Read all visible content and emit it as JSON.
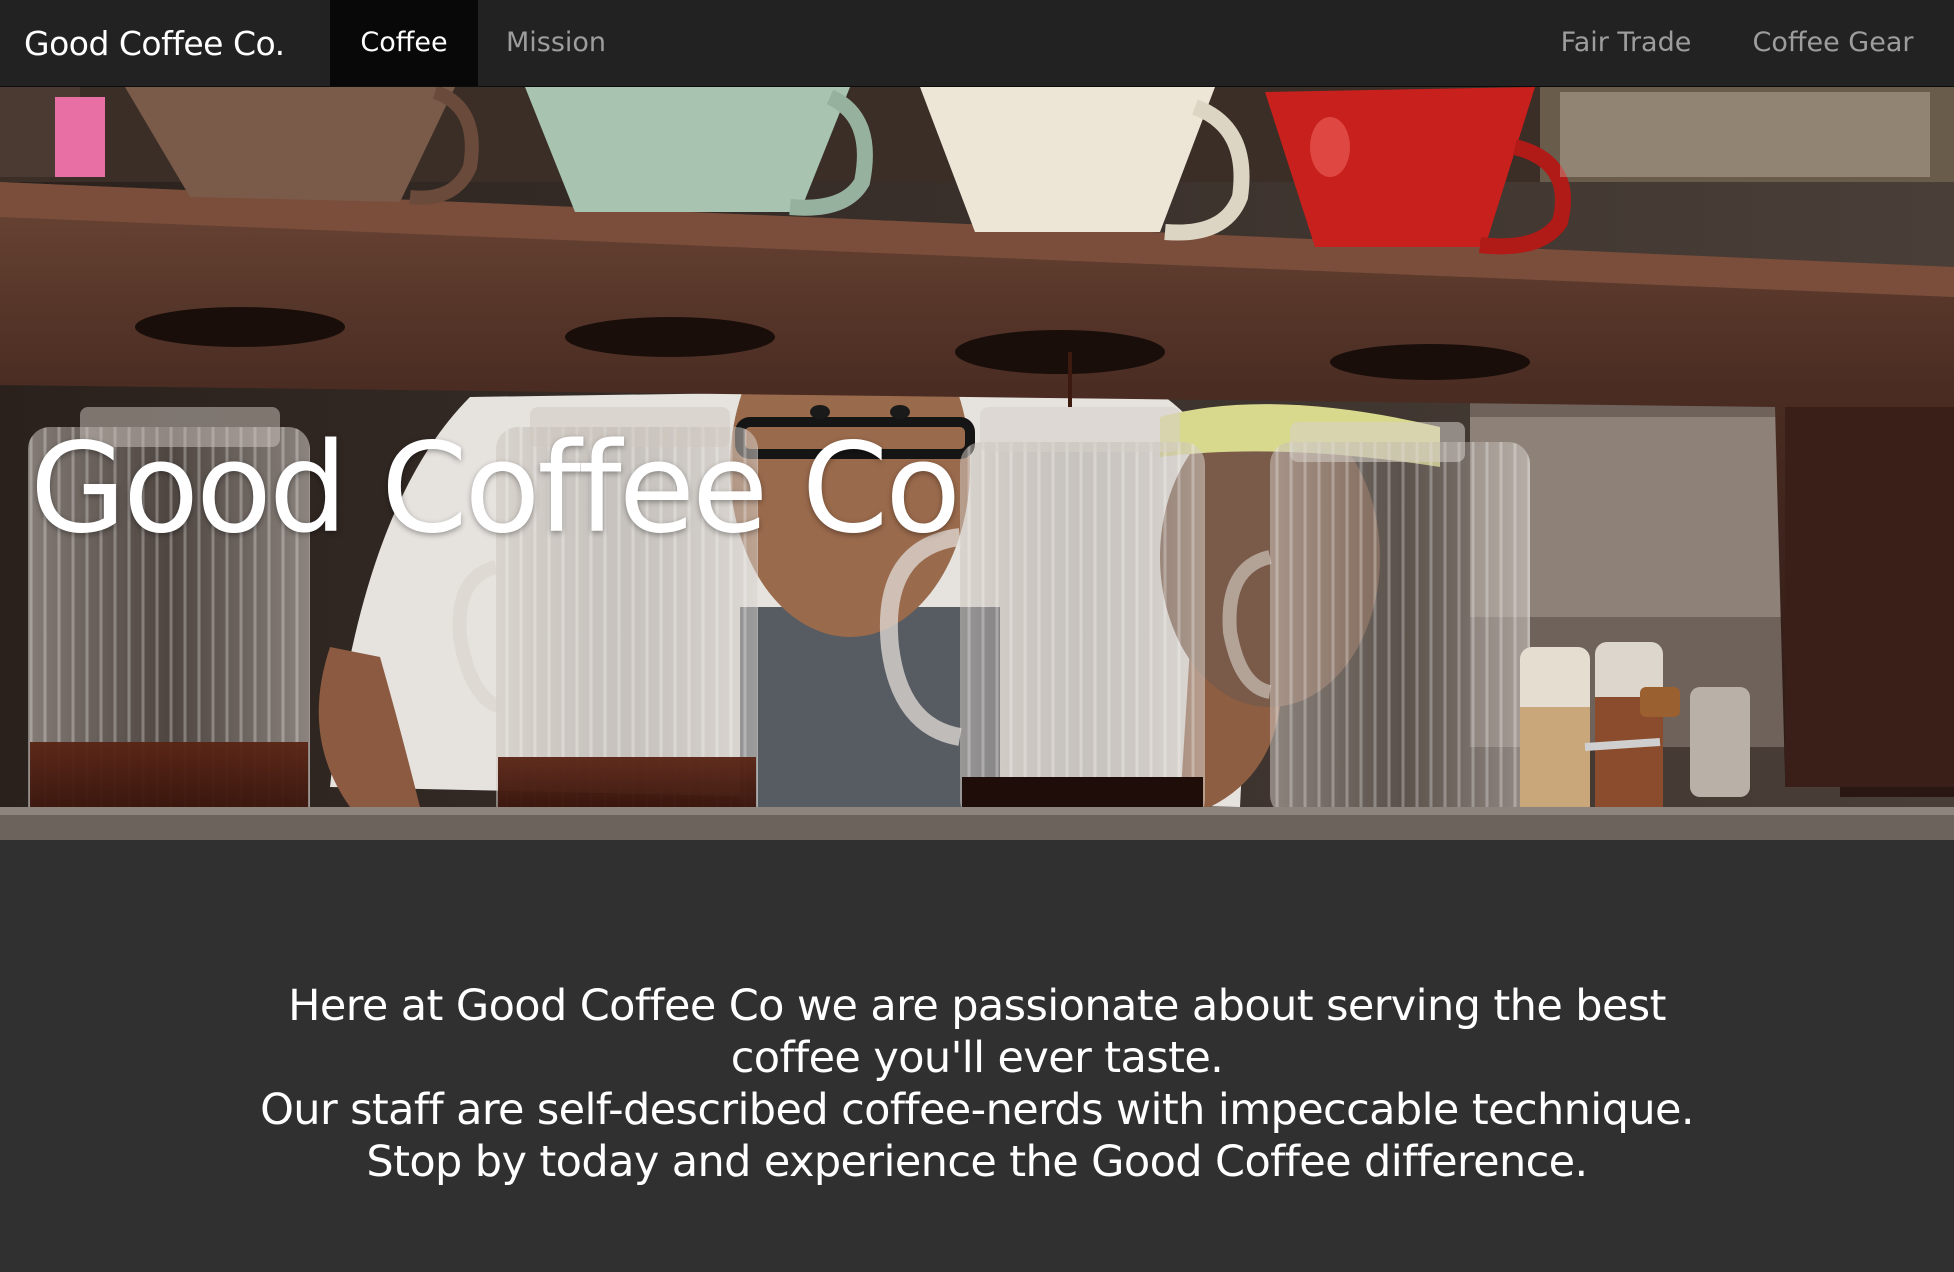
{
  "nav": {
    "brand": "Good Coffee Co.",
    "left_items": [
      {
        "label": "Coffee",
        "active": true
      },
      {
        "label": "Mission",
        "active": false
      }
    ],
    "right_items": [
      {
        "label": "Fair Trade"
      },
      {
        "label": "Coffee Gear"
      }
    ]
  },
  "hero": {
    "title": "Good Coffee Co"
  },
  "intro": {
    "line1": "Here at Good Coffee Co we are passionate about serving the best coffee you'll ever taste.",
    "line2": "Our staff are self-described coffee-nerds with impeccable technique.",
    "line3": "Stop by today and experience the Good Coffee difference."
  },
  "colors": {
    "navbar_bg": "#222222",
    "nav_active_bg": "#080808",
    "nav_text": "#9d9d9d",
    "page_bg": "#303030",
    "text": "#ffffff"
  }
}
